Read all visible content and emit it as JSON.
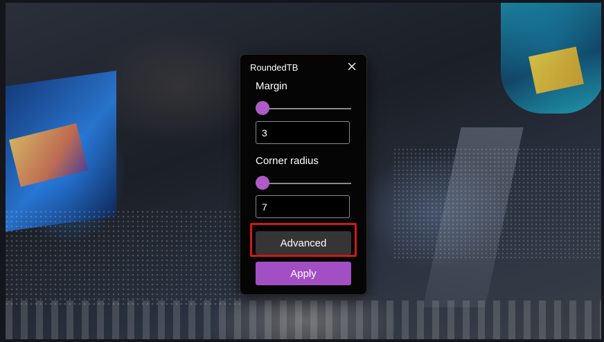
{
  "window": {
    "title": "RoundedTB"
  },
  "margin": {
    "label": "Margin",
    "value": "3",
    "slider_fraction": 0.07
  },
  "corner_radius": {
    "label": "Corner radius",
    "value": "7",
    "slider_fraction": 0.07
  },
  "buttons": {
    "advanced": "Advanced",
    "apply": "Apply"
  },
  "colors": {
    "accent": "#b05ac7",
    "apply_bg": "#a24fc4",
    "advanced_bg": "#353535",
    "dialog_bg": "#050505",
    "highlight": "#d01818"
  },
  "icons": {
    "close": "close-icon"
  }
}
